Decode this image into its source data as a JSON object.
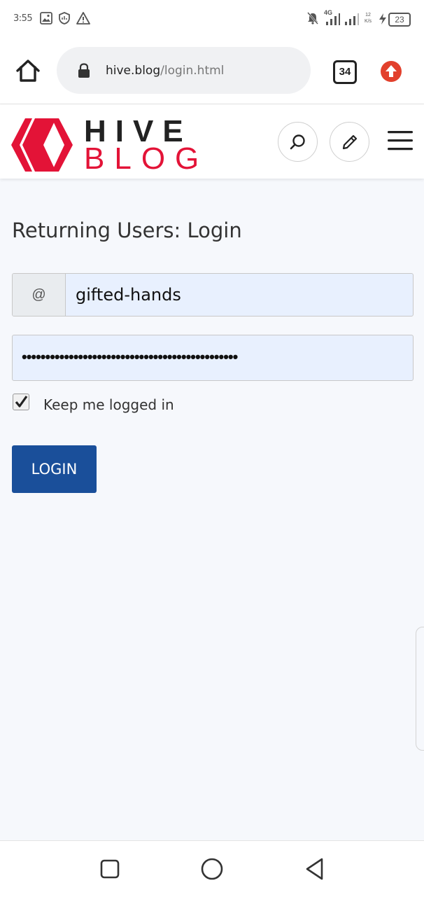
{
  "status_bar": {
    "time": "3:55",
    "network": "4G",
    "speed": "12 K/s",
    "battery": "23"
  },
  "browser": {
    "url_domain": "hive.blog",
    "url_path": "/login.html",
    "tab_count": "34"
  },
  "site": {
    "logo_line1": "HIVE",
    "logo_line2": "BLOG",
    "brand_color": "#e31337"
  },
  "login": {
    "title": "Returning Users: Login",
    "at_symbol": "@",
    "username": "gifted-hands",
    "password_mask": "••••••••••••••••••••••••••••••••••••••••••••••",
    "remember_label": "Keep me logged in",
    "remember_checked": true,
    "button_label": "LOGIN",
    "button_color": "#1a4f9a"
  }
}
